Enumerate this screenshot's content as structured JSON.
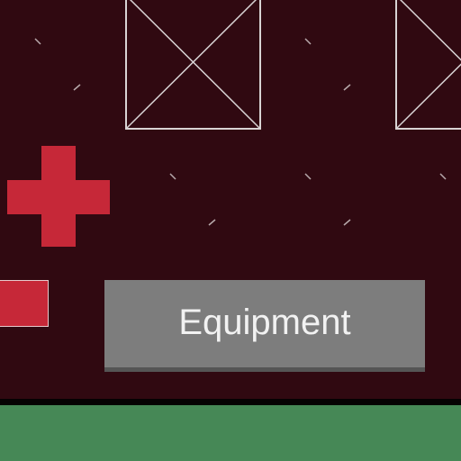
{
  "hud": {
    "equipment_button_label": "Equipment",
    "health_icon_name": "red-cross-icon",
    "empty_slot_icon_name": "empty-slot-x-icon"
  },
  "colors": {
    "panel_background": "#300911",
    "health_red": "#c62838",
    "button_gray": "#7d7d7d",
    "button_text": "#f2f2f2",
    "ground_green": "#468856",
    "slot_outline": "#d8d3d4"
  }
}
